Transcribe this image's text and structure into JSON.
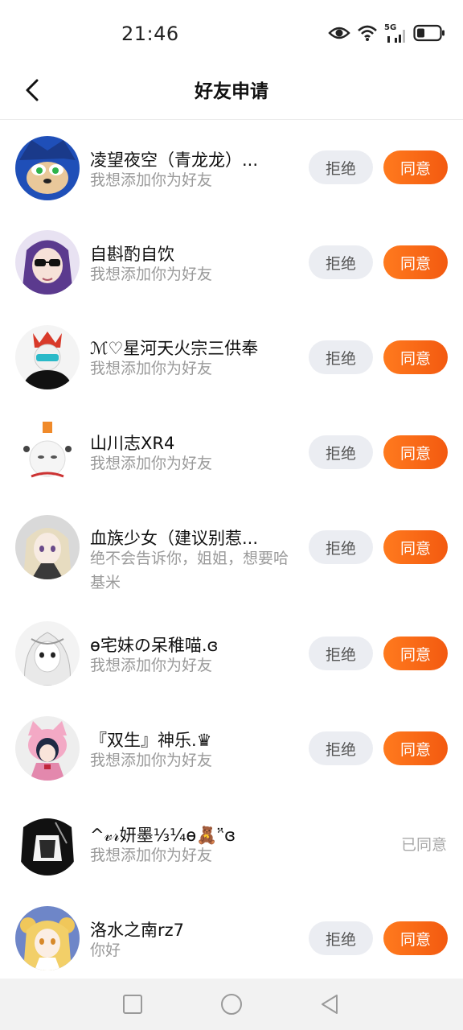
{
  "status": {
    "time": "21:46",
    "network": "5G"
  },
  "header": {
    "title": "好友申请"
  },
  "requests": [
    {
      "name": "凌望夜空（青龙龙）...",
      "message": "我想添加你为好友",
      "reject": "拒绝",
      "accept": "同意"
    },
    {
      "name": "自斟酌自饮",
      "message": "我想添加你为好友",
      "reject": "拒绝",
      "accept": "同意"
    },
    {
      "name": "ℳ♡星河天火宗三供奉",
      "message": "我想添加你为好友",
      "reject": "拒绝",
      "accept": "同意"
    },
    {
      "name": "山川志XR4",
      "message": "我想添加你为好友",
      "reject": "拒绝",
      "accept": "同意"
    },
    {
      "name": "血族少女（建议别惹...",
      "message": "绝不会告诉你，姐姐，想要哈基米",
      "reject": "拒绝",
      "accept": "同意"
    },
    {
      "name": "ɵ宅妹の呆稚喵.ɞ",
      "message": "我想添加你为好友",
      "reject": "拒绝",
      "accept": "同意"
    },
    {
      "name": "『双生』神乐.♛",
      "message": "我想添加你为好友",
      "reject": "拒绝",
      "accept": "同意"
    },
    {
      "name": "^𝓋𝓇妍墨⅓¼ɵ🧸ᵔ̈ɞ",
      "message": "我想添加你为好友",
      "status": "已同意"
    },
    {
      "name": "洛水之南rz7",
      "message": "你好",
      "reject": "拒绝",
      "accept": "同意"
    }
  ]
}
